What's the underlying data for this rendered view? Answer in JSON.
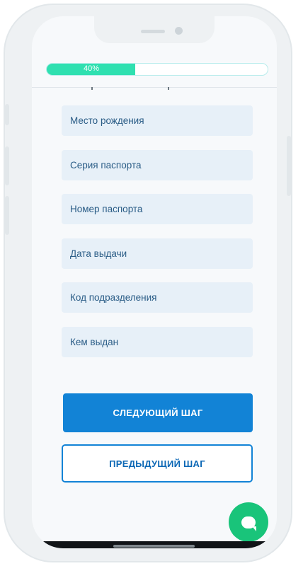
{
  "progress": {
    "label": "40%",
    "value": 0.4
  },
  "form": {
    "fields": [
      {
        "placeholder": "Место рождения"
      },
      {
        "placeholder": "Серия паспорта"
      },
      {
        "placeholder": "Номер паспорта"
      },
      {
        "placeholder": "Дата выдачи"
      },
      {
        "placeholder": "Код подразделения"
      },
      {
        "placeholder": "Кем выдан"
      }
    ]
  },
  "buttons": {
    "next_label": "СЛЕДУЮЩИЙ ШАГ",
    "prev_label": "ПРЕДЫДУЩИЙ ШАГ"
  },
  "chat": {
    "icon": "chat-bubble-icon"
  },
  "colors": {
    "accent": "#1283d6",
    "progress": "#2fe0b0",
    "chat": "#19c47a",
    "field_bg": "#e7f0f8"
  }
}
